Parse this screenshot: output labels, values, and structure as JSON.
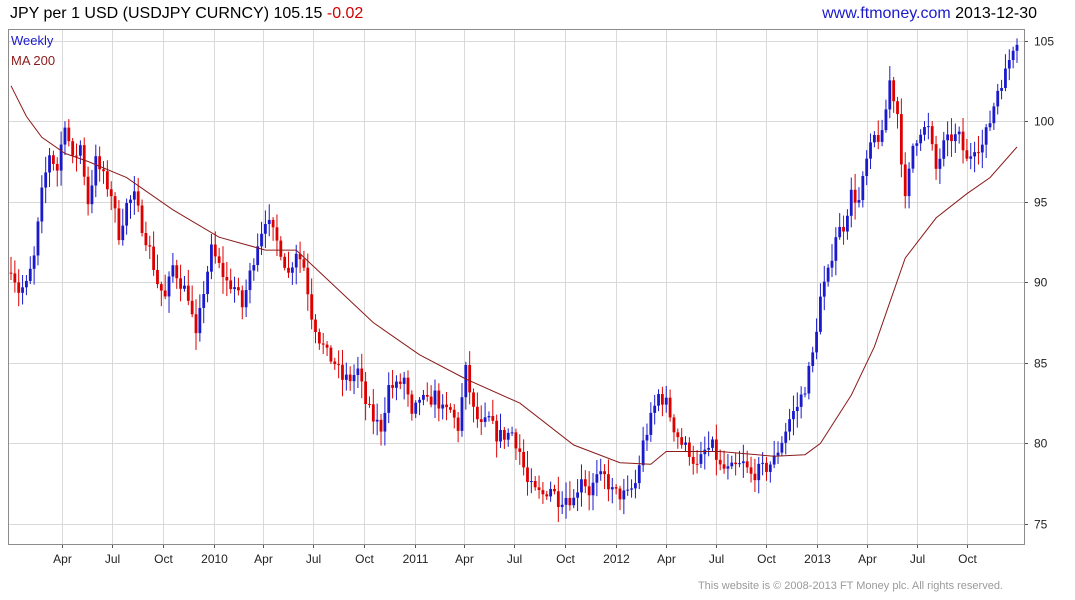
{
  "header": {
    "instrument": "JPY per 1 USD (USDJPY CURNCY) 105.15",
    "change": "-0.02",
    "site": "www.ftmoney.com",
    "date": "2013-12-30"
  },
  "footer": {
    "copyright": "This website is © 2008-2013 FT Money plc. All rights reserved."
  },
  "colors": {
    "up": "#1a1acc",
    "down": "#dd0000",
    "ma": "#8b1a1a",
    "grid": "#d9d9d9",
    "axis": "#555555"
  },
  "chart_data": {
    "type": "candlestick",
    "legend": [
      {
        "name": "Weekly",
        "color": "#1a1acc"
      },
      {
        "name": "MA 200",
        "color": "#8b1a1a"
      }
    ],
    "legend_position": "top-left",
    "x_tick_labels": [
      "Apr",
      "Jul",
      "Oct",
      "2010",
      "Apr",
      "Jul",
      "Oct",
      "2011",
      "Apr",
      "Jul",
      "Oct",
      "2012",
      "Apr",
      "Jul",
      "Oct",
      "2013",
      "Apr",
      "Jul",
      "Oct"
    ],
    "x_tick_dates": [
      "2009-04-01",
      "2009-07-01",
      "2009-10-01",
      "2010-01-01",
      "2010-04-01",
      "2010-07-01",
      "2010-10-01",
      "2011-01-01",
      "2011-04-01",
      "2011-07-01",
      "2011-10-01",
      "2012-01-01",
      "2012-04-01",
      "2012-07-01",
      "2012-10-01",
      "2013-01-01",
      "2013-04-01",
      "2013-07-01",
      "2013-10-01"
    ],
    "x_range": [
      "2008-12-29",
      "2013-12-30"
    ],
    "y_ticks": [
      75,
      80,
      85,
      90,
      95,
      100,
      105
    ],
    "ylim": [
      74.5,
      105.6
    ],
    "grid": true,
    "y_axis_side": "right",
    "close_anchors": [
      [
        "2008-12-29",
        91.0
      ],
      [
        "2009-01-12",
        89.5
      ],
      [
        "2009-01-26",
        89.8
      ],
      [
        "2009-02-09",
        91.5
      ],
      [
        "2009-02-23",
        95.5
      ],
      [
        "2009-03-09",
        98.0
      ],
      [
        "2009-03-23",
        97.0
      ],
      [
        "2009-04-06",
        100.0
      ],
      [
        "2009-04-20",
        97.5
      ],
      [
        "2009-05-04",
        98.5
      ],
      [
        "2009-05-18",
        95.0
      ],
      [
        "2009-06-01",
        97.5
      ],
      [
        "2009-06-15",
        96.5
      ],
      [
        "2009-06-29",
        95.5
      ],
      [
        "2009-07-13",
        93.0
      ],
      [
        "2009-07-27",
        94.8
      ],
      [
        "2009-08-10",
        95.3
      ],
      [
        "2009-08-24",
        93.5
      ],
      [
        "2009-09-07",
        92.0
      ],
      [
        "2009-09-21",
        90.0
      ],
      [
        "2009-10-05",
        89.0
      ],
      [
        "2009-10-19",
        91.0
      ],
      [
        "2009-11-02",
        90.0
      ],
      [
        "2009-11-16",
        89.2
      ],
      [
        "2009-11-30",
        86.5
      ],
      [
        "2009-12-14",
        89.5
      ],
      [
        "2009-12-28",
        92.0
      ],
      [
        "2010-01-11",
        91.0
      ],
      [
        "2010-01-25",
        90.0
      ],
      [
        "2010-02-08",
        89.7
      ],
      [
        "2010-02-22",
        88.5
      ],
      [
        "2010-03-08",
        90.5
      ],
      [
        "2010-03-22",
        92.5
      ],
      [
        "2010-04-05",
        94.0
      ],
      [
        "2010-04-19",
        93.0
      ],
      [
        "2010-05-03",
        92.0
      ],
      [
        "2010-05-17",
        90.5
      ],
      [
        "2010-05-31",
        92.0
      ],
      [
        "2010-06-14",
        91.0
      ],
      [
        "2010-06-28",
        88.0
      ],
      [
        "2010-07-12",
        86.5
      ],
      [
        "2010-07-26",
        85.5
      ],
      [
        "2010-08-09",
        85.0
      ],
      [
        "2010-08-23",
        84.0
      ],
      [
        "2010-09-06",
        84.0
      ],
      [
        "2010-09-20",
        84.5
      ],
      [
        "2010-10-04",
        82.5
      ],
      [
        "2010-10-18",
        81.5
      ],
      [
        "2010-11-01",
        81.0
      ],
      [
        "2010-11-15",
        83.5
      ],
      [
        "2010-11-29",
        83.5
      ],
      [
        "2010-12-13",
        84.0
      ],
      [
        "2010-12-27",
        81.5
      ],
      [
        "2011-01-10",
        82.8
      ],
      [
        "2011-01-24",
        82.5
      ],
      [
        "2011-02-07",
        83.0
      ],
      [
        "2011-02-21",
        82.0
      ],
      [
        "2011-03-07",
        82.0
      ],
      [
        "2011-03-21",
        81.0
      ],
      [
        "2011-04-04",
        84.5
      ],
      [
        "2011-04-18",
        82.0
      ],
      [
        "2011-05-02",
        81.0
      ],
      [
        "2011-05-16",
        81.5
      ],
      [
        "2011-05-30",
        80.5
      ],
      [
        "2011-06-13",
        80.5
      ],
      [
        "2011-06-27",
        80.7
      ],
      [
        "2011-07-11",
        79.5
      ],
      [
        "2011-07-25",
        77.5
      ],
      [
        "2011-08-08",
        77.0
      ],
      [
        "2011-08-22",
        76.8
      ],
      [
        "2011-09-05",
        77.3
      ],
      [
        "2011-09-19",
        76.5
      ],
      [
        "2011-10-03",
        76.7
      ],
      [
        "2011-10-17",
        76.5
      ],
      [
        "2011-10-31",
        78.0
      ],
      [
        "2011-11-14",
        77.0
      ],
      [
        "2011-11-28",
        77.8
      ],
      [
        "2011-12-12",
        77.9
      ],
      [
        "2011-12-26",
        77.0
      ],
      [
        "2012-01-09",
        76.8
      ],
      [
        "2012-01-23",
        76.8
      ],
      [
        "2012-02-06",
        77.5
      ],
      [
        "2012-02-20",
        80.0
      ],
      [
        "2012-03-05",
        81.5
      ],
      [
        "2012-03-19",
        83.0
      ],
      [
        "2012-04-02",
        82.5
      ],
      [
        "2012-04-16",
        81.0
      ],
      [
        "2012-04-30",
        80.0
      ],
      [
        "2012-05-14",
        79.5
      ],
      [
        "2012-05-28",
        78.5
      ],
      [
        "2012-06-11",
        79.5
      ],
      [
        "2012-06-25",
        79.8
      ],
      [
        "2012-07-09",
        78.5
      ],
      [
        "2012-07-23",
        78.3
      ],
      [
        "2012-08-06",
        78.5
      ],
      [
        "2012-08-20",
        78.7
      ],
      [
        "2012-09-03",
        78.0
      ],
      [
        "2012-09-17",
        78.3
      ],
      [
        "2012-10-01",
        78.5
      ],
      [
        "2012-10-15",
        79.0
      ],
      [
        "2012-10-29",
        80.2
      ],
      [
        "2012-11-12",
        81.5
      ],
      [
        "2012-11-26",
        82.3
      ],
      [
        "2012-12-10",
        83.5
      ],
      [
        "2012-12-24",
        85.5
      ],
      [
        "2013-01-07",
        89.0
      ],
      [
        "2013-01-21",
        90.5
      ],
      [
        "2013-02-04",
        93.0
      ],
      [
        "2013-02-18",
        93.5
      ],
      [
        "2013-03-04",
        95.5
      ],
      [
        "2013-03-18",
        95.0
      ],
      [
        "2013-04-01",
        97.5
      ],
      [
        "2013-04-15",
        99.0
      ],
      [
        "2013-04-29",
        99.0
      ],
      [
        "2013-05-13",
        102.5
      ],
      [
        "2013-05-27",
        100.5
      ],
      [
        "2013-06-10",
        95.0
      ],
      [
        "2013-06-24",
        98.5
      ],
      [
        "2013-07-08",
        99.5
      ],
      [
        "2013-07-22",
        99.5
      ],
      [
        "2013-08-05",
        97.0
      ],
      [
        "2013-08-19",
        98.5
      ],
      [
        "2013-09-02",
        99.0
      ],
      [
        "2013-09-16",
        99.0
      ],
      [
        "2013-09-30",
        97.5
      ],
      [
        "2013-10-14",
        98.5
      ],
      [
        "2013-10-28",
        98.5
      ],
      [
        "2013-11-11",
        100.0
      ],
      [
        "2013-11-25",
        102.0
      ],
      [
        "2013-12-09",
        103.0
      ],
      [
        "2013-12-23",
        104.7
      ],
      [
        "2013-12-30",
        105.15
      ]
    ],
    "ma_200": [
      [
        "2008-12-29",
        102.2
      ],
      [
        "2009-01-26",
        100.3
      ],
      [
        "2009-02-23",
        99.0
      ],
      [
        "2009-04-06",
        98.0
      ],
      [
        "2009-05-18",
        97.5
      ],
      [
        "2009-07-27",
        96.5
      ],
      [
        "2009-10-19",
        94.5
      ],
      [
        "2010-01-11",
        92.8
      ],
      [
        "2010-04-05",
        92.0
      ],
      [
        "2010-05-31",
        92.0
      ],
      [
        "2010-07-26",
        90.2
      ],
      [
        "2010-10-18",
        87.5
      ],
      [
        "2011-01-10",
        85.5
      ],
      [
        "2011-04-04",
        84.0
      ],
      [
        "2011-07-11",
        82.5
      ],
      [
        "2011-10-17",
        79.9
      ],
      [
        "2012-01-09",
        78.8
      ],
      [
        "2012-03-05",
        78.7
      ],
      [
        "2012-04-02",
        79.5
      ],
      [
        "2012-07-09",
        79.5
      ],
      [
        "2012-10-15",
        79.2
      ],
      [
        "2012-12-10",
        79.3
      ],
      [
        "2013-01-07",
        80.0
      ],
      [
        "2013-03-04",
        83.0
      ],
      [
        "2013-04-15",
        86.0
      ],
      [
        "2013-06-10",
        91.5
      ],
      [
        "2013-08-05",
        94.0
      ],
      [
        "2013-09-30",
        95.5
      ],
      [
        "2013-11-11",
        96.5
      ],
      [
        "2013-12-30",
        98.4
      ]
    ]
  }
}
